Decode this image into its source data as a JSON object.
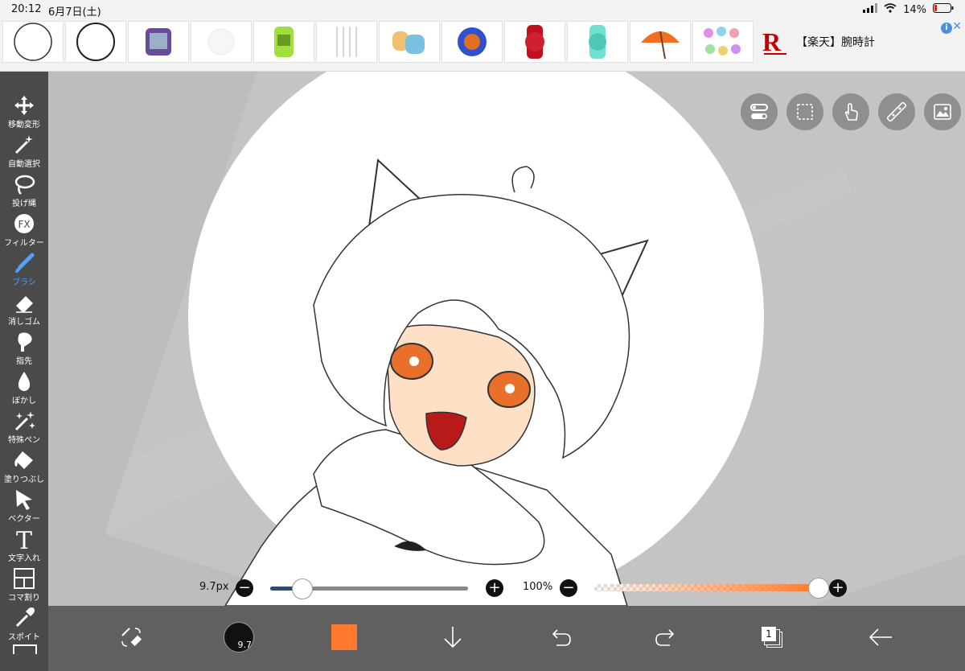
{
  "status_bar": {
    "time": "20:12",
    "date": "6月7日(土)",
    "battery": "14%"
  },
  "ad": {
    "text": "【楽天】腕時計",
    "logo": "R",
    "info_icon": "info-icon",
    "close": "✕"
  },
  "tools": [
    {
      "name": "move",
      "label": "移動変形",
      "icon": "move-arrows-icon"
    },
    {
      "name": "auto-select",
      "label": "自動選択",
      "icon": "magic-wand-icon"
    },
    {
      "name": "lasso",
      "label": "投げ縄",
      "icon": "lasso-icon"
    },
    {
      "name": "filter",
      "label": "フィルター",
      "icon": "fx-icon",
      "glyph": "FX"
    },
    {
      "name": "brush",
      "label": "ブラシ",
      "icon": "brush-icon",
      "active": true
    },
    {
      "name": "eraser",
      "label": "消しゴム",
      "icon": "eraser-icon"
    },
    {
      "name": "finger",
      "label": "指先",
      "icon": "finger-icon"
    },
    {
      "name": "blur",
      "label": "ぼかし",
      "icon": "drop-icon"
    },
    {
      "name": "special-pen",
      "label": "特殊ペン",
      "icon": "sparkle-pen-icon"
    },
    {
      "name": "fill",
      "label": "塗りつぶし",
      "icon": "bucket-icon"
    },
    {
      "name": "vector",
      "label": "ベクター",
      "icon": "cursor-arrow-icon"
    },
    {
      "name": "text",
      "label": "文字入れ",
      "icon": "text-icon",
      "glyph": "T"
    },
    {
      "name": "panel",
      "label": "コマ割り",
      "icon": "panel-icon"
    },
    {
      "name": "eyedropper",
      "label": "スポイト",
      "icon": "eyedropper-icon"
    }
  ],
  "brush_size": {
    "value": 9.7,
    "label": "9.7px",
    "minus": "−",
    "plus": "+"
  },
  "opacity": {
    "value": 100,
    "label": "100%",
    "minus": "−",
    "plus": "+"
  },
  "bottom": {
    "brush_size_small": "9.7",
    "layers_count": "1",
    "color": "#ff7a2e"
  },
  "colors": {
    "accent": "#4aa3ff",
    "toolbar": "#4a4a4a",
    "bottom_bar": "#606060",
    "canvas_bg": "#bdbdbd"
  }
}
